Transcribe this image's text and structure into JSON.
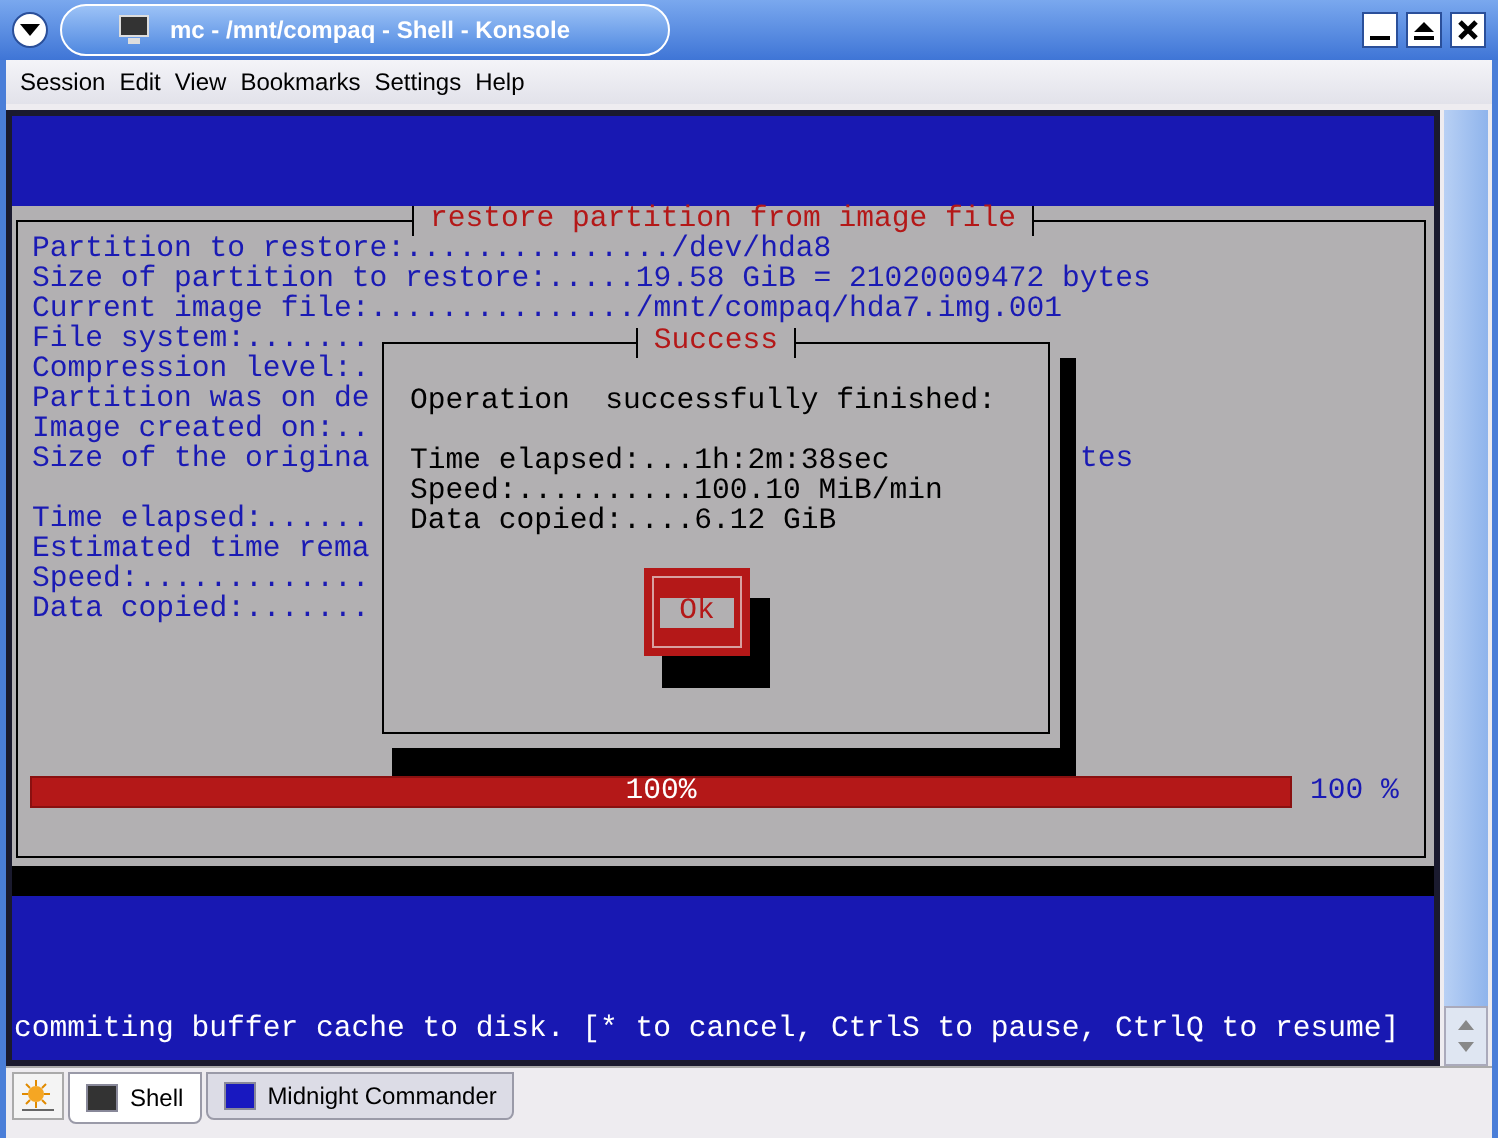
{
  "window": {
    "title": "mc - /mnt/compaq - Shell - Konsole"
  },
  "menu": [
    "Session",
    "Edit",
    "View",
    "Bookmarks",
    "Settings",
    "Help"
  ],
  "terminal": {
    "panel": {
      "title": "restore partition from image file",
      "info_lines": [
        "Partition to restore:.............../dev/hda8",
        "Size of partition to restore:.....19.58 GiB = 21020009472 bytes",
        "Current image file:.............../mnt/compaq/hda7.img.001",
        "File system:.......",
        "Compression level:.",
        "Partition was on de",
        "Image created on:..",
        "Size of the origina"
      ],
      "right_fragment": "tes",
      "progress_lines": [
        "Time elapsed:......",
        "Estimated time rema",
        "Speed:.............",
        "Data copied:......."
      ],
      "progress": {
        "level": 1,
        "label": "100%",
        "reading": "100 %"
      }
    },
    "dialog": {
      "title": "Success",
      "message": "Operation  successfully finished:",
      "lines": [
        "Time elapsed:...1h:2m:38sec",
        "Speed:..........100.10 MiB/min",
        "Data copied:....6.12 GiB"
      ],
      "button": "Ok"
    },
    "status_line": "commiting buffer cache to disk. [* to cancel, CtrlS to pause, CtrlQ to resume]"
  },
  "tabs": [
    {
      "label": "Shell",
      "selected": true
    },
    {
      "label": "Midnight Commander",
      "selected": false
    }
  ]
}
